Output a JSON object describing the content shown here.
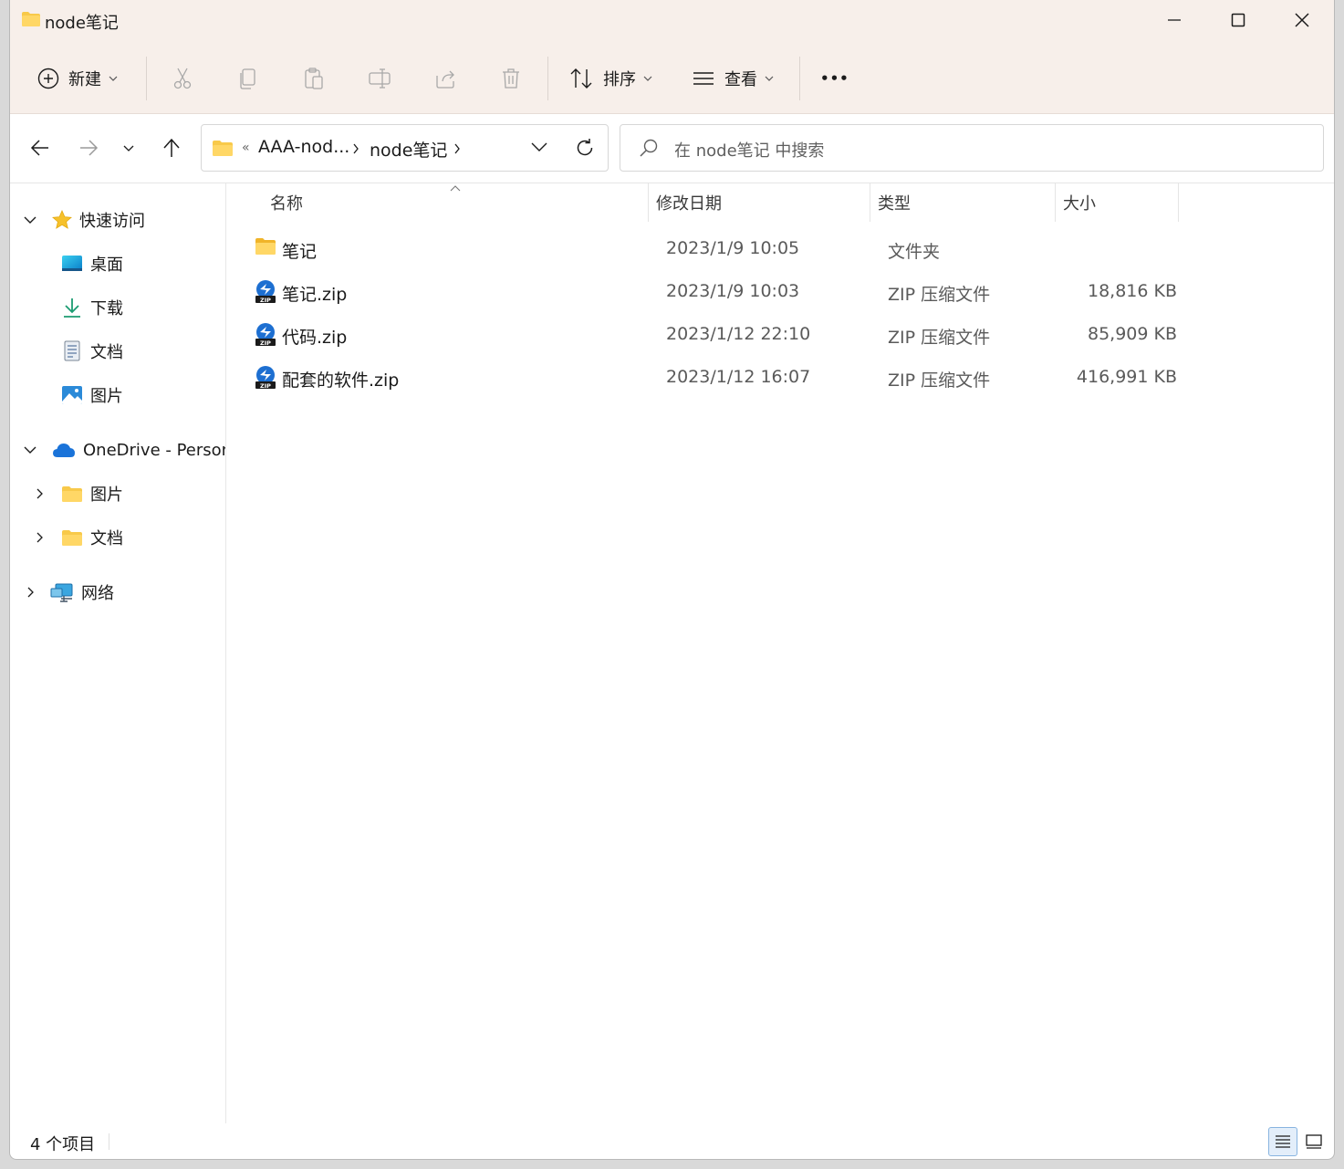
{
  "window": {
    "title": "node笔记"
  },
  "toolbar": {
    "new_label": "新建",
    "sort_label": "排序",
    "view_label": "查看",
    "more_label": "•••"
  },
  "address": {
    "overflow": "«",
    "crumbs": [
      "AAA-nod...",
      "node笔记"
    ]
  },
  "search": {
    "placeholder": "在 node笔记 中搜索"
  },
  "sidebar": {
    "quick_access": "快速访问",
    "quick_items": [
      {
        "label": "桌面",
        "icon": "desktop-icon"
      },
      {
        "label": "下载",
        "icon": "download-icon"
      },
      {
        "label": "文档",
        "icon": "document-icon"
      },
      {
        "label": "图片",
        "icon": "pictures-icon"
      }
    ],
    "onedrive": "OneDrive - Persona",
    "onedrive_items": [
      {
        "label": "图片"
      },
      {
        "label": "文档"
      }
    ],
    "network": "网络"
  },
  "columns": {
    "name": "名称",
    "date": "修改日期",
    "type": "类型",
    "size": "大小"
  },
  "files": [
    {
      "name": "笔记",
      "date": "2023/1/9 10:05",
      "type": "文件夹",
      "size": "",
      "icon": "folder-icon"
    },
    {
      "name": "笔记.zip",
      "date": "2023/1/9 10:03",
      "type": "ZIP 压缩文件",
      "size": "18,816 KB",
      "icon": "zip-icon"
    },
    {
      "name": "代码.zip",
      "date": "2023/1/12 22:10",
      "type": "ZIP 压缩文件",
      "size": "85,909 KB",
      "icon": "zip-icon"
    },
    {
      "name": "配套的软件.zip",
      "date": "2023/1/12 16:07",
      "type": "ZIP 压缩文件",
      "size": "416,991 KB",
      "icon": "zip-icon"
    }
  ],
  "status": {
    "count": "4 个项目"
  },
  "colors": {
    "accent": "#0067c0",
    "chrome": "#f7efea",
    "folder": "#f8c94a"
  }
}
